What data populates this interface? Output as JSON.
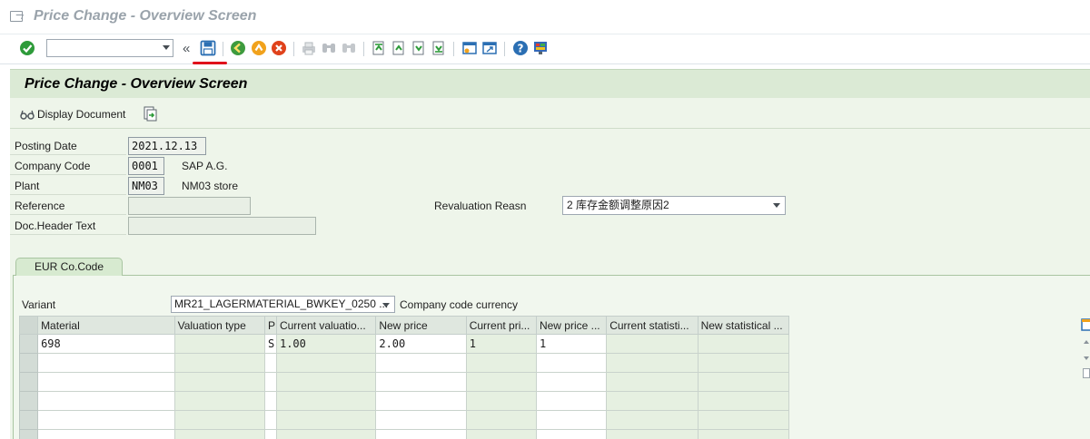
{
  "window": {
    "title": "Price Change - Overview Screen"
  },
  "toolbar": {
    "command_field_value": "",
    "icons": [
      "enter-icon",
      "command-dropdown-icon",
      "collapse-icon",
      "save-icon",
      "back-icon",
      "exit-icon",
      "cancel-icon",
      "print-icon",
      "find-icon",
      "find-next-icon",
      "first-page-icon",
      "previous-page-icon",
      "next-page-icon",
      "last-page-icon",
      "create-session-icon",
      "shortcut-icon",
      "help-icon",
      "customize-layout-icon"
    ],
    "collapse_label": "«"
  },
  "screen": {
    "title": "Price Change - Overview Screen",
    "display_document_label": "Display Document"
  },
  "header_fields": {
    "posting_date": {
      "label": "Posting Date",
      "value": "2021.12.13"
    },
    "company_code": {
      "label": "Company Code",
      "value": "0001",
      "desc": "SAP A.G."
    },
    "plant": {
      "label": "Plant",
      "value": "NM03",
      "desc": "NM03 store"
    },
    "reference": {
      "label": "Reference",
      "value": ""
    },
    "doc_header_text": {
      "label": "Doc.Header Text",
      "value": ""
    },
    "revaluation_reason": {
      "label": "Revaluation Reasn",
      "value": "2 库存金额调整原因2"
    }
  },
  "tabs": [
    {
      "label": "EUR  Co.Code"
    }
  ],
  "variant": {
    "label": "Variant",
    "value": "MR21_LAGERMATERIAL_BWKEY_0250 ...",
    "note": "Company code currency"
  },
  "table": {
    "columns": [
      "Material",
      "Valuation type",
      "P",
      "Current valuatio...",
      "New price",
      "Current pri...",
      "New price ...",
      "Current statisti...",
      "New statistical ..."
    ],
    "rows": [
      [
        "698",
        "",
        "S",
        "1.00",
        "2.00",
        "1",
        "1",
        "",
        ""
      ],
      [
        "",
        "",
        "",
        "",
        "",
        "",
        "",
        "",
        ""
      ],
      [
        "",
        "",
        "",
        "",
        "",
        "",
        "",
        "",
        ""
      ],
      [
        "",
        "",
        "",
        "",
        "",
        "",
        "",
        "",
        ""
      ],
      [
        "",
        "",
        "",
        "",
        "",
        "",
        "",
        "",
        ""
      ],
      [
        "",
        "",
        "",
        "",
        "",
        "",
        "",
        "",
        ""
      ]
    ]
  },
  "colors": {
    "screen_header_bg": "#dbead5",
    "content_bg": "#eef5ea",
    "annotation_red": "#e0121b",
    "enter_green": "#2e9b3a"
  }
}
